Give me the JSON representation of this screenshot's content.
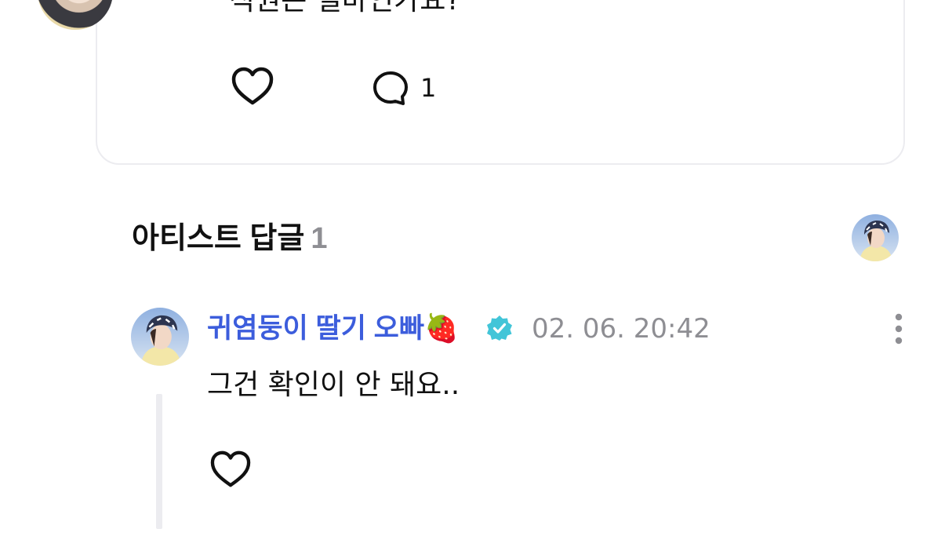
{
  "post": {
    "text": "직원은 얼마인가요?",
    "comment_count": "1",
    "icons": {
      "avatar": "profile-photo",
      "like": "heart-outline-icon",
      "comment": "speech-bubble-icon"
    }
  },
  "artist_replies": {
    "title": "아티스트 답글",
    "count": "1",
    "icons": {
      "artist_avatar": "artist-profile-photo"
    }
  },
  "reply": {
    "author": "귀염둥이 딸기 오빠🍓",
    "timestamp": "02. 06. 20:42",
    "text": "그건 확인이 안 돼요..",
    "verified": true,
    "icons": {
      "verified": "verified-badge-icon",
      "more": "more-vertical-icon",
      "like": "heart-outline-icon"
    }
  },
  "colors": {
    "author_name": "#3c5ddc",
    "timestamp": "#8e8e93",
    "verified_badge": "#42c5d8",
    "card_border": "#ececf0",
    "thread_line": "#ececf0"
  }
}
